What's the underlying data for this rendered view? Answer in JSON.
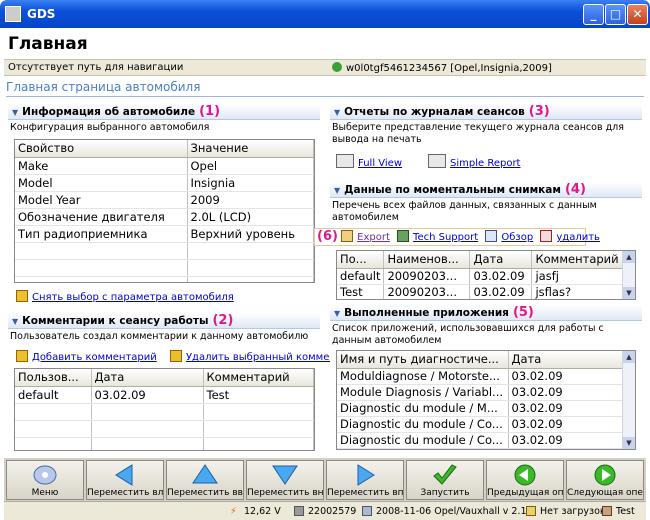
{
  "window": {
    "title": "GDS"
  },
  "header": {
    "title": "Главная"
  },
  "navbar": {
    "left_text": "Отсутствует путь для навигации",
    "vehicle": "w0l0tgf5461234567 [Opel,Insignia,2009]"
  },
  "page_subtitle": "Главная страница автомобиля",
  "vehicle_info": {
    "heading": "Информация об автомобиле",
    "num": "(1)",
    "desc": "Конфигурация выбранного автомобиля",
    "columns": [
      "Свойство",
      "Значение"
    ],
    "rows": [
      [
        "Make",
        "Opel"
      ],
      [
        "Model",
        "Insignia"
      ],
      [
        "Model Year",
        "2009"
      ],
      [
        "Обозначение двигателя",
        "2.0L (LCD)"
      ],
      [
        "Тип радиоприемника",
        "Верхний уровень"
      ]
    ],
    "clear_link": "Снять выбор с параметра автомобиля"
  },
  "session_comments": {
    "heading": "Комментарии к сеансу работы",
    "num": "(2)",
    "desc": "Пользователь создал комментарии к данному автомобилю",
    "add_link": "Добавить комментарий",
    "delete_link": "Удалить выбранный комментари",
    "columns": [
      "Пользов...",
      "Дата",
      "Комментарий"
    ],
    "rows": [
      [
        "default",
        "03.02.09",
        "Test"
      ]
    ]
  },
  "session_reports": {
    "heading": "Отчеты по журналам сеансов",
    "num": "(3)",
    "desc": "Выберите представление текущего журнала сеансов для вывода на печать",
    "full_view": "Full View",
    "simple_report": "Simple Report"
  },
  "snapshots": {
    "heading": "Данные по моментальным снимкам",
    "num": "(4)",
    "desc": "Перечень всех файлов данных, связанных с данным автомобилем",
    "num6": "(6)",
    "actions": [
      "Export",
      "Tech Support",
      "Обзор",
      "удалить"
    ],
    "columns": [
      "По...",
      "Наименов...",
      "Дата",
      "Комментарий"
    ],
    "rows": [
      [
        "default",
        "20090203...",
        "03.02.09",
        "jasfj"
      ],
      [
        "Test",
        "20090203...",
        "03.02.09",
        "jsflas?"
      ]
    ]
  },
  "applications": {
    "heading": "Выполненные приложения",
    "num": "(5)",
    "desc": "Список приложений, использовавшихся для работы с данным автомобилем",
    "columns": [
      "Имя и путь диагностиче...",
      "Дата"
    ],
    "rows": [
      [
        "Moduldiagnose / Motorste...",
        "03.02.09"
      ],
      [
        "Module Diagnosis / Variabl...",
        "03.02.09"
      ],
      [
        "Diagnostic du module / M...",
        "03.02.09"
      ],
      [
        "Diagnostic du module / Co...",
        "03.02.09"
      ],
      [
        "Diagnostic du module / Co...",
        "03.02.09"
      ]
    ]
  },
  "toolbar": {
    "buttons": [
      "Меню",
      "Переместить влево",
      "Переместить вверх",
      "Переместить вниз",
      "Переместить вправо",
      "Запустить",
      "Предыдущая операция",
      "Следующая операция"
    ]
  },
  "status": {
    "voltage": "12,62 V",
    "id": "22002579",
    "version": "2008-11-06 Opel/Vauxhall v 2.1",
    "downloads": "Нет загрузок",
    "user": "Test"
  },
  "colors": {
    "accent": "#e0168f",
    "title_bar": "#0a50d8",
    "link": "#0000cc"
  }
}
